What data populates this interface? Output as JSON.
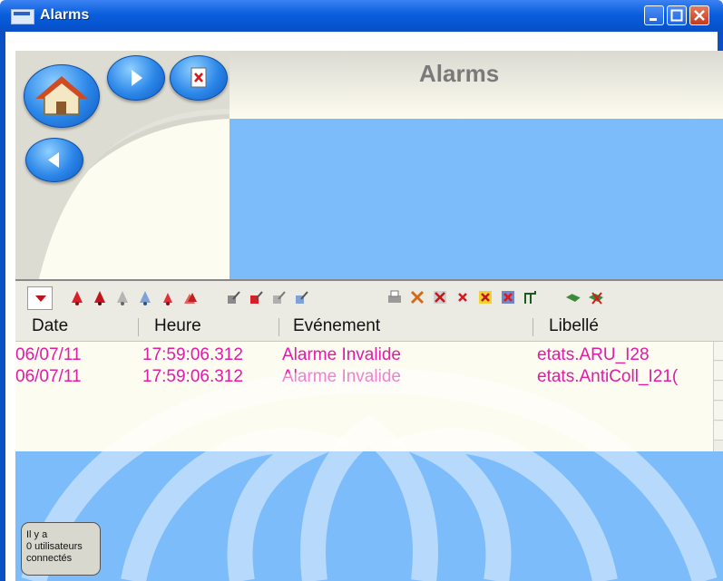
{
  "window": {
    "title": "Alarms",
    "controls": {
      "minimize": "_",
      "maximize": "□",
      "close": "X"
    }
  },
  "page": {
    "title": "Alarms"
  },
  "nav": {
    "home": "home-icon",
    "forward": "play-forward-icon",
    "document": "close-document-icon",
    "back": "play-back-icon"
  },
  "toolbar": {
    "icons": [
      "bell-red-icon",
      "bell-red-2-icon",
      "bell-grey-icon",
      "bell-blue-icon",
      "bell-red-small-icon",
      "bell-stack-icon",
      "acknowledge-icon",
      "acknowledge-red-icon",
      "acknowledge-grey-icon",
      "acknowledge-blue-icon",
      "printer-icon",
      "filter-icon",
      "delete-filter-icon",
      "cross-filter-icon",
      "cross-yellow-icon",
      "cross-box-icon",
      "signal-icon",
      "handshake-icon",
      "handshake-cross-icon"
    ]
  },
  "table": {
    "columns": [
      "Date",
      "Heure",
      "Evénement",
      "Libellé"
    ],
    "rows": [
      [
        "06/07/11",
        "17:59:06.312",
        "Alarme Invalide",
        "etats.ARU_I28"
      ],
      [
        "06/07/11",
        "17:59:06.312",
        "Alarme Invalide",
        "etats.AntiColl_I21("
      ]
    ]
  },
  "status": {
    "lines": [
      "Il y a",
      "0 utilisateurs",
      "connectés"
    ]
  },
  "colors": {
    "titlebar": "#0a5fdc",
    "panel_blue": "#7dbcfa",
    "alarm_text": "#e21aa8"
  }
}
